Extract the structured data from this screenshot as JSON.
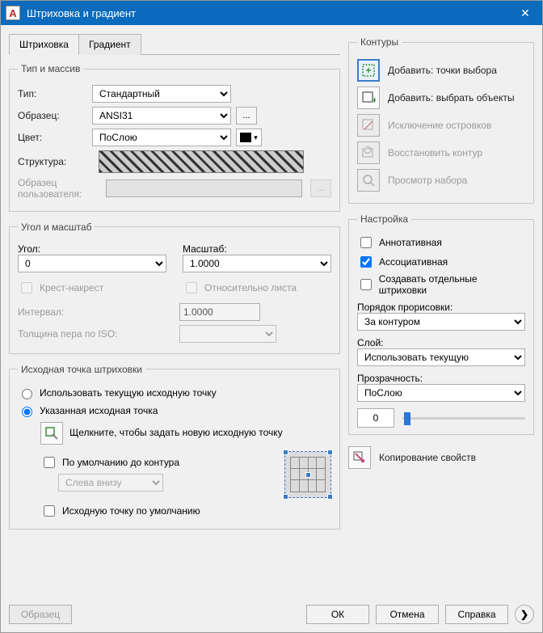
{
  "window": {
    "title": "Штриховка и градиент"
  },
  "tabs": {
    "hatch": "Штриховка",
    "gradient": "Градиент"
  },
  "type_array": {
    "legend": "Тип и массив",
    "type_label": "Тип:",
    "type_value": "Стандартный",
    "pattern_label": "Образец:",
    "pattern_value": "ANSI31",
    "color_label": "Цвет:",
    "color_value": "ПоСлою",
    "swatch_label": "Структура:",
    "custom_label": "Образец пользователя:"
  },
  "angle_scale": {
    "legend": "Угол и масштаб",
    "angle_label": "Угол:",
    "angle_value": "0",
    "scale_label": "Масштаб:",
    "scale_value": "1.0000",
    "double_label": "Крест-накрест",
    "relative_label": "Относительно листа",
    "spacing_label": "Интервал:",
    "spacing_value": "1.0000",
    "iso_label": "Толщина пера по ISO:"
  },
  "origin": {
    "legend": "Исходная точка штриховки",
    "use_current": "Использовать текущую исходную точку",
    "specified": "Указанная исходная точка",
    "click_hint": "Щелкните, чтобы задать новую исходную точку",
    "default_bound": "По умолчанию до контура",
    "pos_value": "Слева внизу",
    "store_default": "Исходную точку по умолчанию"
  },
  "boundaries": {
    "legend": "Контуры",
    "add_pick": "Добавить: точки выбора",
    "add_select": "Добавить: выбрать объекты",
    "remove": "Исключение островков",
    "recreate": "Восстановить контур",
    "view": "Просмотр набора"
  },
  "options": {
    "legend": "Настройка",
    "annotative": "Аннотативная",
    "associative": "Ассоциативная",
    "separate": "Создавать отдельные штриховки",
    "draw_order_label": "Порядок прорисовки:",
    "draw_order_value": "За контуром",
    "layer_label": "Слой:",
    "layer_value": "Использовать текущую",
    "transparency_label": "Прозрачность:",
    "transparency_mode": "ПоСлою",
    "transparency_value": "0"
  },
  "inherit": {
    "label": "Копирование свойств"
  },
  "footer": {
    "preview": "Образец",
    "ok": "ОК",
    "cancel": "Отмена",
    "help": "Справка"
  }
}
